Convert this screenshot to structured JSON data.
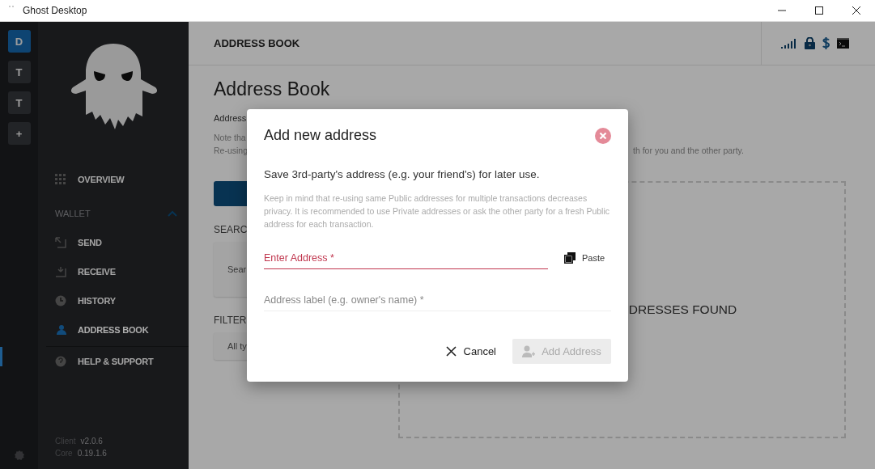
{
  "window": {
    "title": "Ghost Desktop"
  },
  "accounts": [
    {
      "label": "D",
      "selected": true
    },
    {
      "label": "T",
      "selected": false
    },
    {
      "label": "T",
      "selected": false
    },
    {
      "label": "+",
      "selected": false
    }
  ],
  "sidebar": {
    "nav": [
      {
        "kind": "link",
        "label": "OVERVIEW",
        "selected": false
      },
      {
        "kind": "section",
        "label": "WALLET",
        "expanded": true
      },
      {
        "kind": "link",
        "label": "SEND",
        "selected": false
      },
      {
        "kind": "link",
        "label": "RECEIVE",
        "selected": false
      },
      {
        "kind": "link",
        "label": "HISTORY",
        "selected": false
      },
      {
        "kind": "link",
        "label": "ADDRESS BOOK",
        "selected": true
      }
    ],
    "support": [
      {
        "label": "HELP & SUPPORT",
        "selected": false
      }
    ],
    "versions": [
      {
        "label": "Client",
        "value": "v2.0.6"
      },
      {
        "label": "Core",
        "value": "0.19.1.6"
      }
    ]
  },
  "header": {
    "title": "ADDRESS BOOK"
  },
  "page": {
    "title": "Address Book",
    "intro": "Address",
    "note_lines": [
      "Note tha",
      "Re-using"
    ],
    "note_tail": "th for you and the other party.",
    "search_label": "SEARC",
    "search_placeholder": "Sear",
    "filter_label": "FILTER",
    "filter_value": "All ty",
    "empty_text": "DRESSES FOUND"
  },
  "dialog": {
    "title": "Add new address",
    "lead": "Save 3rd-party's address (e.g. your friend's) for later use.",
    "note": "Keep in mind that re-using same Public addresses for multiple transactions decreases privacy. It is recommended to use Private addresses or ask the other party for a fresh Public address for each transaction.",
    "fields": [
      {
        "placeholder": "Enter Address *",
        "invalid": true
      },
      {
        "placeholder": "Address label (e.g. owner's name) *",
        "invalid": false
      }
    ],
    "paste": "Paste",
    "cancel": "Cancel",
    "submit": {
      "label": "Add Address",
      "disabled": true
    }
  }
}
